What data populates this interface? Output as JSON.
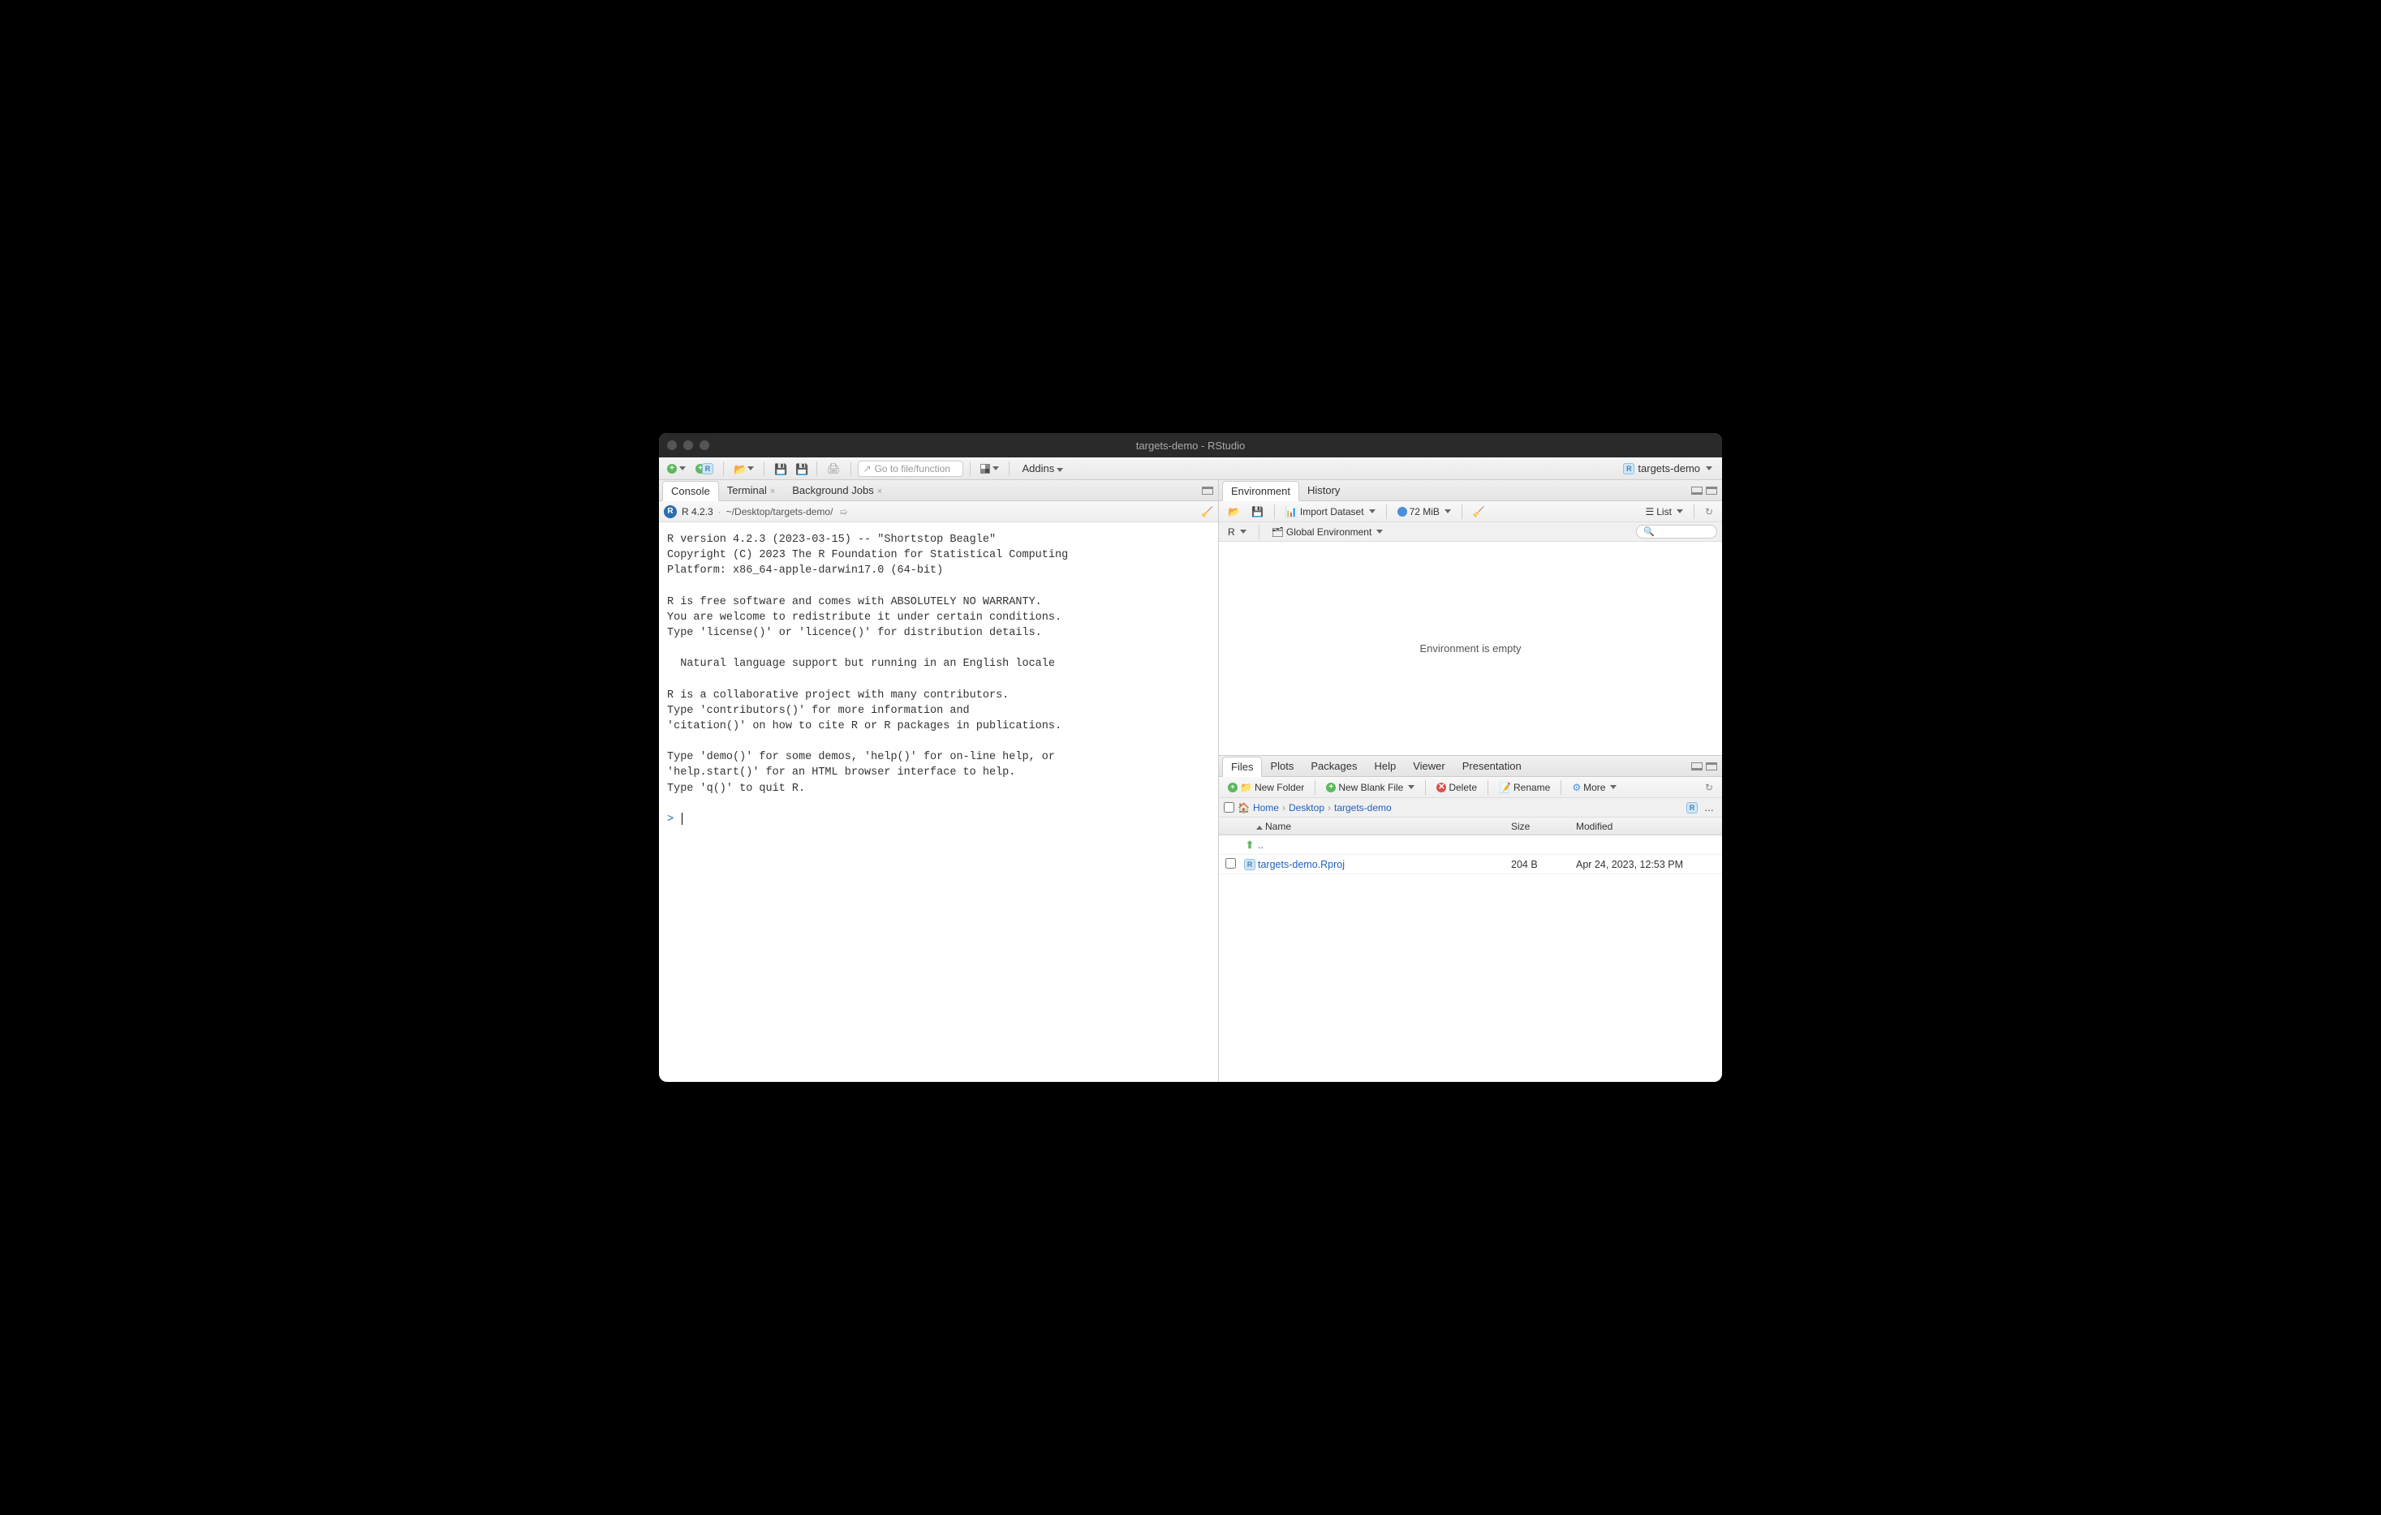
{
  "window": {
    "title": "targets-demo - RStudio"
  },
  "toolbar": {
    "goto_placeholder": "Go to file/function",
    "addins": "Addins",
    "project": "targets-demo"
  },
  "left": {
    "tabs": [
      "Console",
      "Terminal",
      "Background Jobs"
    ],
    "active_tab": 0,
    "r_version": "R 4.2.3",
    "path": "~/Desktop/targets-demo/",
    "console_text": "R version 4.2.3 (2023-03-15) -- \"Shortstop Beagle\"\nCopyright (C) 2023 The R Foundation for Statistical Computing\nPlatform: x86_64-apple-darwin17.0 (64-bit)\n\nR is free software and comes with ABSOLUTELY NO WARRANTY.\nYou are welcome to redistribute it under certain conditions.\nType 'license()' or 'licence()' for distribution details.\n\n  Natural language support but running in an English locale\n\nR is a collaborative project with many contributors.\nType 'contributors()' for more information and\n'citation()' on how to cite R or R packages in publications.\n\nType 'demo()' for some demos, 'help()' for on-line help, or\n'help.start()' for an HTML browser interface to help.\nType 'q()' to quit R.\n",
    "prompt": ">"
  },
  "env": {
    "tabs": [
      "Environment",
      "History"
    ],
    "import": "Import Dataset",
    "memory": "72 MiB",
    "r_menu": "R",
    "scope": "Global Environment",
    "view": "List",
    "empty": "Environment is empty"
  },
  "files": {
    "tabs": [
      "Files",
      "Plots",
      "Packages",
      "Help",
      "Viewer",
      "Presentation"
    ],
    "new_folder": "New Folder",
    "new_blank": "New Blank File",
    "delete": "Delete",
    "rename": "Rename",
    "more": "More",
    "breadcrumbs": [
      "Home",
      "Desktop",
      "targets-demo"
    ],
    "columns": {
      "name": "Name",
      "size": "Size",
      "modified": "Modified"
    },
    "updir": "..",
    "rows": [
      {
        "name": "targets-demo.Rproj",
        "size": "204 B",
        "modified": "Apr 24, 2023, 12:53 PM"
      }
    ]
  }
}
